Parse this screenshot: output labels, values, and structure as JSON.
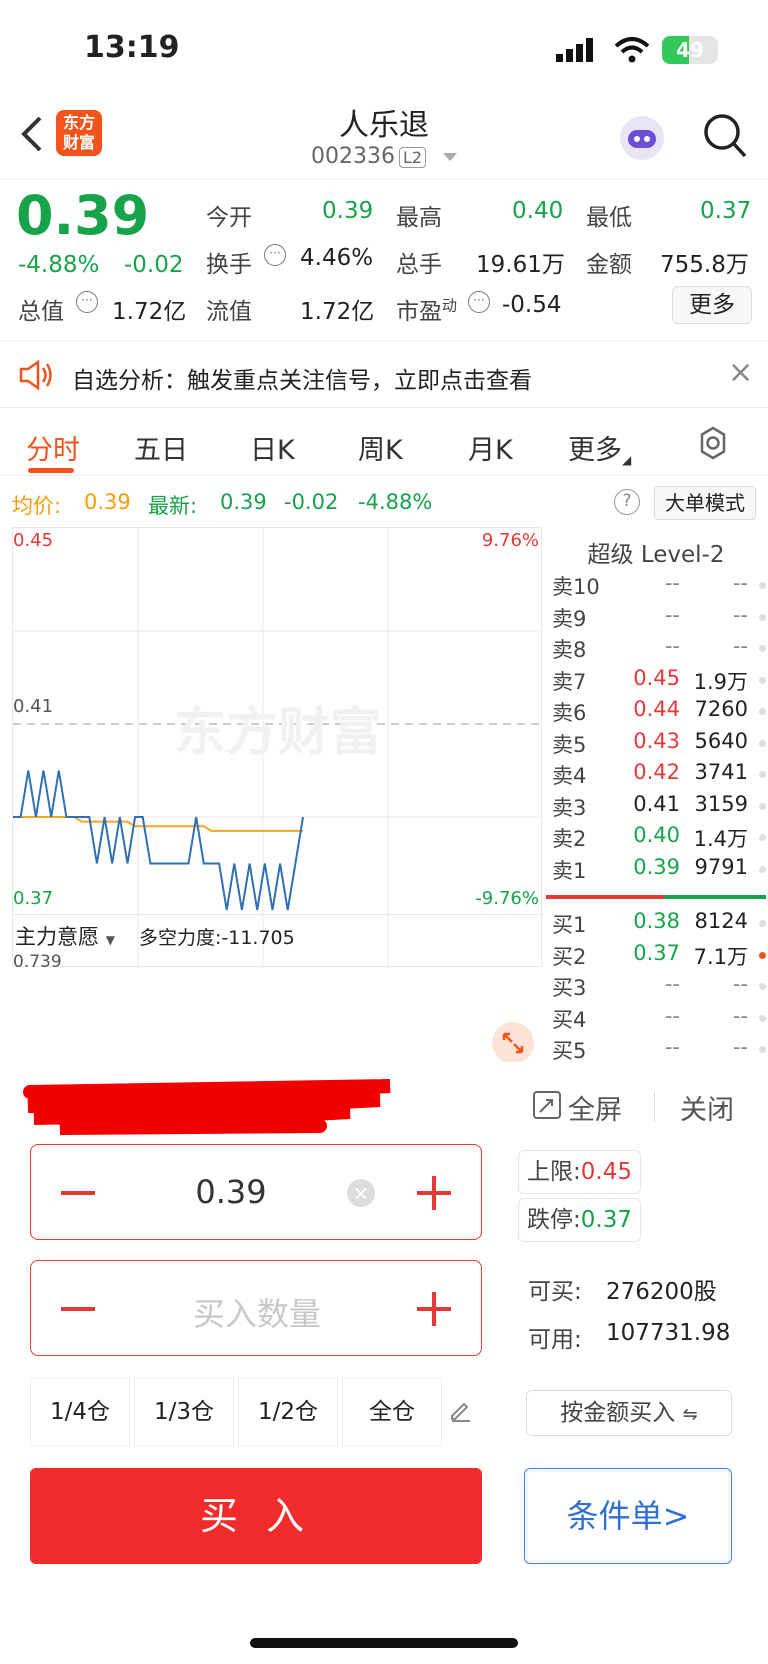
{
  "status_bar": {
    "time": "13:19",
    "battery": "49"
  },
  "header": {
    "logo": "东方\n财富",
    "stock_name": "人乐退",
    "stock_code": "002336",
    "level_badge": "L2",
    "back_icon": "chevron-left-icon",
    "assistant_icon": "robot-avatar-icon",
    "search_icon": "search-icon"
  },
  "quote": {
    "price": "0.39",
    "change_pct": "-4.88%",
    "change": "-0.02",
    "open_label": "今开",
    "open": "0.39",
    "high_label": "最高",
    "high": "0.40",
    "low_label": "最低",
    "low": "0.37",
    "turnover_label": "换手",
    "turnover": "4.46%",
    "volume_label": "总手",
    "volume": "19.61万",
    "amount_label": "金额",
    "amount": "755.8万",
    "mktcap_label": "总值",
    "mktcap": "1.72亿",
    "float_label": "流值",
    "float": "1.72亿",
    "pe_label": "市盈",
    "pe_sup": "动",
    "pe": "-0.54",
    "more_label": "更多"
  },
  "signal": {
    "text": "自选分析：触发重点关注信号，立即点击查看",
    "close": "×"
  },
  "tabs": [
    {
      "label": "分时"
    },
    {
      "label": "五日"
    },
    {
      "label": "日K"
    },
    {
      "label": "周K"
    },
    {
      "label": "月K"
    },
    {
      "label": "更多"
    }
  ],
  "infobar": {
    "avg_label": "均价:",
    "avg": "0.39",
    "last_label": "最新:",
    "last": "0.39",
    "change": "-0.02",
    "change_pct": "-4.88%",
    "help": "?",
    "mode": "大单模式"
  },
  "chart_data": {
    "type": "line",
    "y_top_label": "0.45",
    "y_top_pct": "9.76%",
    "y_mid_label": "0.41",
    "y_bottom_label": "0.37",
    "y_bottom_pct": "-9.76%",
    "ylim": [
      0.37,
      0.45
    ],
    "watermark": "东方财富",
    "series": [
      {
        "color": "#2f6fb4",
        "values": [
          0.39,
          0.39,
          0.4,
          0.39,
          0.4,
          0.39,
          0.4,
          0.39,
          0.39,
          0.39,
          0.39,
          0.38,
          0.39,
          0.38,
          0.39,
          0.38,
          0.39,
          0.39,
          0.38,
          0.38,
          0.38,
          0.38,
          0.38,
          0.38,
          0.39,
          0.38,
          0.38,
          0.38,
          0.37,
          0.38,
          0.37,
          0.38,
          0.37,
          0.38,
          0.37,
          0.38,
          0.37,
          0.38,
          0.39
        ]
      },
      {
        "color": "#f5a623",
        "values": [
          0.39,
          0.39,
          0.39,
          0.39,
          0.39,
          0.39,
          0.39,
          0.39,
          0.39,
          0.389,
          0.389,
          0.389,
          0.389,
          0.389,
          0.389,
          0.389,
          0.388,
          0.388,
          0.388,
          0.388,
          0.388,
          0.388,
          0.388,
          0.388,
          0.388,
          0.388,
          0.387,
          0.387,
          0.387,
          0.387,
          0.387,
          0.387,
          0.387,
          0.387,
          0.387,
          0.387,
          0.387,
          0.387,
          0.387
        ]
      }
    ]
  },
  "indicator": {
    "name": "主力意愿",
    "label": "多空力度:-11.705",
    "value": "0.739"
  },
  "orderbook": {
    "title": "超级 Level-2",
    "asks": [
      {
        "label": "卖10",
        "price": "--",
        "vol": "--"
      },
      {
        "label": "卖9",
        "price": "--",
        "vol": "--"
      },
      {
        "label": "卖8",
        "price": "--",
        "vol": "--"
      },
      {
        "label": "卖7",
        "price": "0.45",
        "vol": "1.9万",
        "color": "red"
      },
      {
        "label": "卖6",
        "price": "0.44",
        "vol": "7260",
        "color": "red"
      },
      {
        "label": "卖5",
        "price": "0.43",
        "vol": "5640",
        "color": "red"
      },
      {
        "label": "卖4",
        "price": "0.42",
        "vol": "3741",
        "color": "red"
      },
      {
        "label": "卖3",
        "price": "0.41",
        "vol": "3159",
        "color": "dark"
      },
      {
        "label": "卖2",
        "price": "0.40",
        "vol": "1.4万",
        "color": "green"
      },
      {
        "label": "卖1",
        "price": "0.39",
        "vol": "9791",
        "color": "green"
      }
    ],
    "bids": [
      {
        "label": "买1",
        "price": "0.38",
        "vol": "8124",
        "color": "green"
      },
      {
        "label": "买2",
        "price": "0.37",
        "vol": "7.1万",
        "color": "green",
        "dot": "#f0531c"
      },
      {
        "label": "买3",
        "price": "--",
        "vol": "--"
      },
      {
        "label": "买4",
        "price": "--",
        "vol": "--"
      },
      {
        "label": "买5",
        "price": "--",
        "vol": "--"
      }
    ]
  },
  "panel": {
    "fullscreen": "全屏",
    "close": "关闭",
    "price_value": "0.39",
    "qty_placeholder": "买入数量",
    "upper_label": "上限:",
    "upper": "0.45",
    "limit_down_label": "跌停:",
    "limit_down": "0.37",
    "can_buy_label": "可买:",
    "can_buy": "276200股",
    "available_label": "可用:",
    "available": "107731.98",
    "positions": [
      "1/4仓",
      "1/3仓",
      "1/2仓",
      "全仓"
    ],
    "amount_buy": "按金额买入",
    "buy": "买 入",
    "condition": "条件单>"
  }
}
